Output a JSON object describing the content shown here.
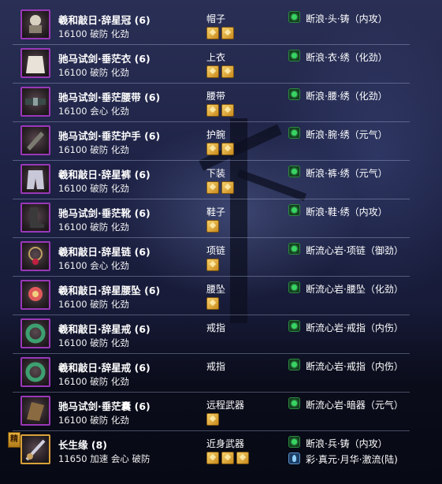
{
  "items": [
    {
      "name": "羲和敲日·辞星冠 (6)",
      "stats": "16100 破防 化劲",
      "slot": "帽子",
      "gems": 2,
      "enhance": "断浪·头·铸（内攻）",
      "icon": "hat-icon"
    },
    {
      "name": "驰马试剑·垂茫衣 (6)",
      "stats": "16100 破防 化劲",
      "slot": "上衣",
      "gems": 2,
      "enhance": "断浪·衣·绣（化劲）",
      "icon": "robe-icon"
    },
    {
      "name": "驰马试剑·垂茫腰带 (6)",
      "stats": "16100 会心 化劲",
      "slot": "腰带",
      "gems": 2,
      "enhance": "断浪·腰·绣（化劲）",
      "icon": "belt-icon"
    },
    {
      "name": "驰马试剑·垂茫护手 (6)",
      "stats": "16100 破防 化劲",
      "slot": "护腕",
      "gems": 2,
      "enhance": "断浪·腕·绣（元气）",
      "icon": "bracer-icon"
    },
    {
      "name": "羲和敲日·辞星裤 (6)",
      "stats": "16100 破防 化劲",
      "slot": "下装",
      "gems": 2,
      "enhance": "断浪·裤·绣（元气）",
      "icon": "pants-icon"
    },
    {
      "name": "驰马试剑·垂茫靴 (6)",
      "stats": "16100 破防 化劲",
      "slot": "鞋子",
      "gems": 1,
      "enhance": "断浪·鞋·绣（内攻）",
      "icon": "boots-icon"
    },
    {
      "name": "羲和敲日·辞星链 (6)",
      "stats": "16100 会心 化劲",
      "slot": "项链",
      "gems": 1,
      "enhance": "断流心岩·项链（御劲）",
      "icon": "necklace-icon"
    },
    {
      "name": "羲和敲日·辞星腰坠 (6)",
      "stats": "16100 破防 化劲",
      "slot": "腰坠",
      "gems": 1,
      "enhance": "断流心岩·腰坠（化劲）",
      "icon": "pendant-icon"
    },
    {
      "name": "羲和敲日·辞星戒 (6)",
      "stats": "16100 破防 化劲",
      "slot": "戒指",
      "gems": 0,
      "enhance": "断流心岩·戒指（内伤）",
      "icon": "ring-icon"
    },
    {
      "name": "羲和敲日·辞星戒 (6)",
      "stats": "16100 破防 化劲",
      "slot": "戒指",
      "gems": 0,
      "enhance": "断流心岩·戒指（内伤）",
      "icon": "ring-icon"
    },
    {
      "name": "驰马试剑·垂茫囊 (6)",
      "stats": "16100 破防 化劲",
      "slot": "远程武器",
      "gems": 1,
      "enhance": "断流心岩·暗器（元气）",
      "icon": "pouch-icon"
    },
    {
      "name": "长生缘 (8)",
      "stats": "11650 加速 会心 破防",
      "slot": "近身武器",
      "gems": 3,
      "enhance": "断浪·兵·铸（内攻）",
      "enhance2": "彩·真元·月华·激流(陆)",
      "badge": "精",
      "icon": "weapon-icon"
    }
  ]
}
